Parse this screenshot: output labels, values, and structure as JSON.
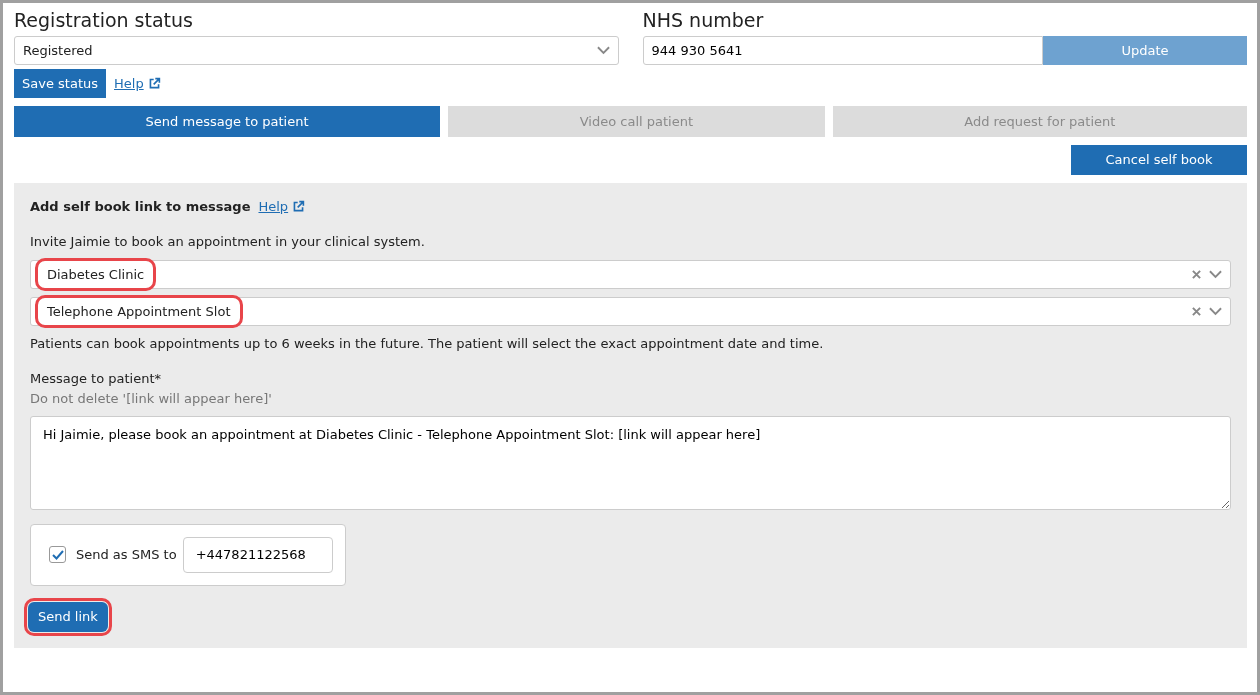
{
  "registration": {
    "title": "Registration status",
    "value": "Registered",
    "save": "Save status",
    "help": "Help"
  },
  "nhs": {
    "title": "NHS number",
    "value": "944 930 5641",
    "button": "Update",
    "button_disabled": true
  },
  "actions": [
    {
      "label": "Send message to patient",
      "disabled": false
    },
    {
      "label": "Video call patient",
      "disabled": true
    },
    {
      "label": "Add request for patient",
      "disabled": true
    }
  ],
  "cancel_button": "Cancel self book",
  "panel": {
    "title": "Add self book link to message",
    "help": "Help",
    "intro": "Invite Jaimie to book an appointment in your clinical system.",
    "selects": [
      {
        "value": "Diabetes Clinic",
        "highlighted": true
      },
      {
        "value": "Telephone Appointment Slot",
        "highlighted": true
      }
    ],
    "note": "Patients can book appointments up to 6 weeks in the future. The patient will select the exact appointment date and time.",
    "message_label": "Message to patient*",
    "message_hint": "Do not delete '[link will appear here]'",
    "message": "Hi Jaimie, please book an appointment at Diabetes Clinic - Telephone Appointment Slot: [link will appear here]",
    "sms": {
      "label": "Send as SMS to",
      "checked": true,
      "number": "+447821122568"
    },
    "send": {
      "label": "Send link",
      "highlighted": true
    }
  }
}
